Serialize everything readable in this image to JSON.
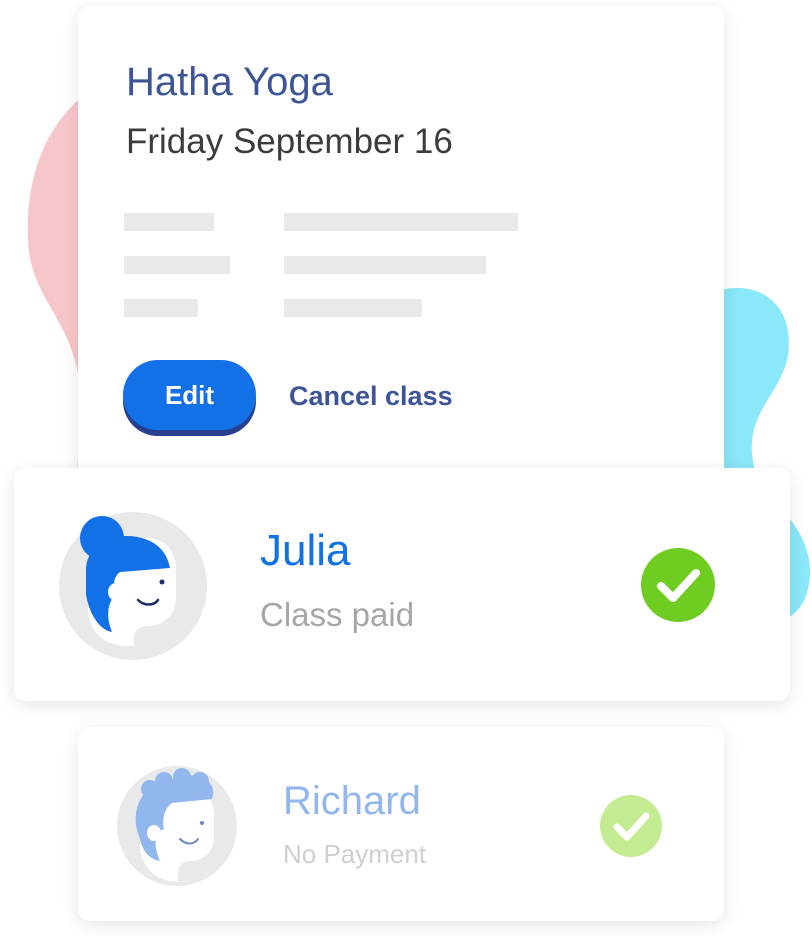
{
  "class_card": {
    "title": "Hatha Yoga",
    "date": "Friday September 16",
    "edit_label": "Edit",
    "cancel_label": "Cancel class"
  },
  "students": [
    {
      "name": "Julia",
      "status": "Class paid",
      "check_color": "#6fcc21"
    },
    {
      "name": "Richard",
      "status": "No Payment",
      "check_color": "#c3eb92"
    }
  ],
  "colors": {
    "primary": "#1271e6",
    "title_blue": "#3d5596",
    "blob_pink": "#f7c6cb",
    "blob_cyan": "#8be8fa"
  }
}
